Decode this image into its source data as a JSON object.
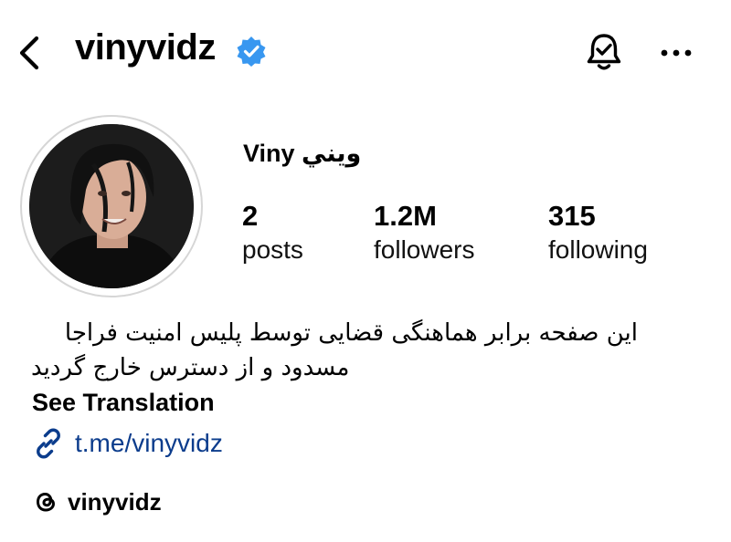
{
  "header": {
    "username": "vinyvidz",
    "icons": {
      "back": "chevron-left-icon",
      "verified": "verified-badge-icon",
      "notifications": "bell-check-icon",
      "more": "more-horizontal-icon"
    },
    "verified_color": "#3897f0"
  },
  "profile": {
    "display_name": "Viny ويني",
    "stats": [
      {
        "value": "2",
        "label": "posts"
      },
      {
        "value": "1.2M",
        "label": "followers"
      },
      {
        "value": "315",
        "label": "following"
      }
    ],
    "bio_lines": [
      "این صفحه برابر هماهنگی قضایی توسط پلیس امنیت فراجا",
      "مسدود و از دسترس خارج گردید"
    ],
    "see_translation": "See Translation",
    "link": {
      "text": "t.me/vinyvidz",
      "icon": "link-icon",
      "color": "#0b3c8c"
    },
    "threads": {
      "handle": "vinyvidz",
      "icon": "threads-icon"
    }
  }
}
